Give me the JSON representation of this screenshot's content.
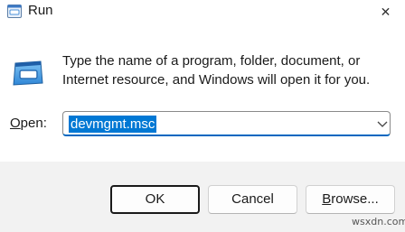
{
  "window": {
    "title": "Run",
    "close_glyph": "✕"
  },
  "icons": {
    "title": "run-dialog-icon",
    "main": "run-dialog-icon",
    "close": "close-icon",
    "dropdown": "chevron-down-icon"
  },
  "description": "Type the name of a program, folder, document, or Internet resource, and Windows will open it for you.",
  "open_field": {
    "label_accel": "O",
    "label_rest": "pen:",
    "value": "devmgmt.msc"
  },
  "buttons": {
    "ok": "OK",
    "cancel": "Cancel",
    "browse_accel": "B",
    "browse_rest": "rowse..."
  },
  "watermark": "wsxdn.com",
  "colors": {
    "accent": "#0078d4",
    "footer_bg": "#f2f2f2"
  }
}
